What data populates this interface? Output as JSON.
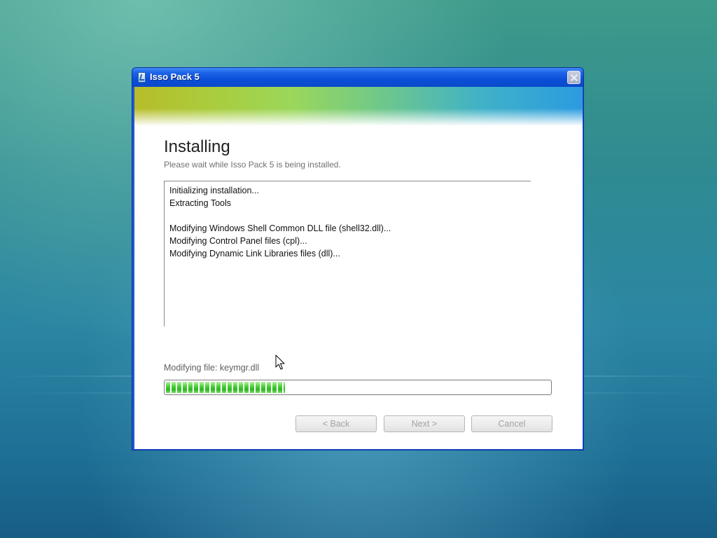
{
  "window": {
    "title": "Isso Pack 5"
  },
  "page": {
    "heading": "Installing",
    "subheading": "Please wait while Isso Pack 5 is being installed."
  },
  "log": {
    "lines": [
      "Initializing installation...",
      "Extracting Tools",
      "",
      "Modifying Windows Shell Common DLL file (shell32.dll)...",
      "Modifying Control Panel files (cpl)...",
      "Modifying Dynamic Link Libraries files (dll)..."
    ]
  },
  "status": {
    "text": "Modifying file: keymgr.dll"
  },
  "progress": {
    "fraction": 0.31
  },
  "buttons": {
    "back": "< Back",
    "next": "Next >",
    "cancel": "Cancel"
  },
  "colors": {
    "title_bar": "#0a4fd9",
    "progress_green": "#2fb423",
    "disabled_text": "#a3a3a3"
  },
  "icons": {
    "app": "installer-icon",
    "close": "close-icon",
    "cursor": "mouse-pointer-icon"
  }
}
